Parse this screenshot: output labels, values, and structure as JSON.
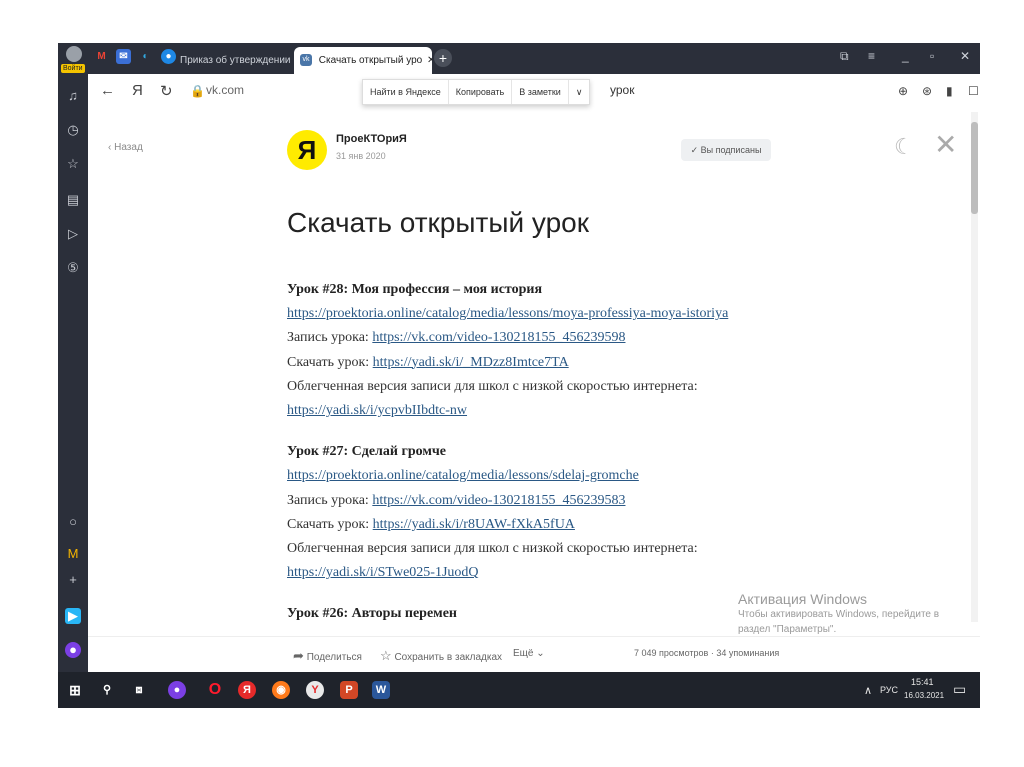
{
  "browser": {
    "login_label": "Войти",
    "tabs": [
      {
        "label": "Приказ об утверждении п"
      },
      {
        "label": "Скачать открытый уро"
      }
    ],
    "new_tab": "+",
    "url": "vk.com",
    "address_title": "урок",
    "context_menu": [
      "Найти в Яндексе",
      "Копировать",
      "В заметки"
    ]
  },
  "post": {
    "back_label": "Назад",
    "avatar_letter": "Я",
    "author": "ПроеКТОриЯ",
    "date": "31 янв 2020",
    "subscribe_label": "Вы подписаны",
    "title": "Скачать открытый урок",
    "lessons": [
      {
        "title": "Урок #28: Моя профессия – моя история",
        "link": "https://proektoria.online/catalog/media/lessons/moya-professiya-moya-istoriya",
        "record_label": "Запись урока: ",
        "record_link": "https://vk.com/video-130218155_456239598",
        "download_label": "Скачать урок: ",
        "download_link": "https://yadi.sk/i/_MDzz8Imtce7TA",
        "light_label": "Облегченная версия записи для школ с низкой скоростью интернета:",
        "light_link": "https://yadi.sk/i/ycpvbIIbdtc-nw"
      },
      {
        "title": "Урок #27: Сделай громче",
        "link": "https://proektoria.online/catalog/media/lessons/sdelaj-gromche",
        "record_label": "Запись урока: ",
        "record_link": "https://vk.com/video-130218155_456239583",
        "download_label": "Скачать урок: ",
        "download_link": "https://yadi.sk/i/r8UAW-fXkA5fUA",
        "light_label": "Облегченная версия записи для школ с низкой скоростью интернета:",
        "light_link": "https://yadi.sk/i/STwe025-1JuodQ"
      },
      {
        "title": "Урок #26: Авторы перемен"
      }
    ],
    "share_label": "Поделиться",
    "bookmark_label": "Сохранить в закладках",
    "more_label": "Ещё",
    "stats": "7 049 просмотров · 34 упоминания"
  },
  "watermark": {
    "line1": "Активация Windows",
    "line2": "Чтобы активировать Windows, перейдите в",
    "line3": "раздел \"Параметры\"."
  },
  "taskbar": {
    "lang": "РУС",
    "time": "15:41",
    "date": "16.03.2021"
  }
}
